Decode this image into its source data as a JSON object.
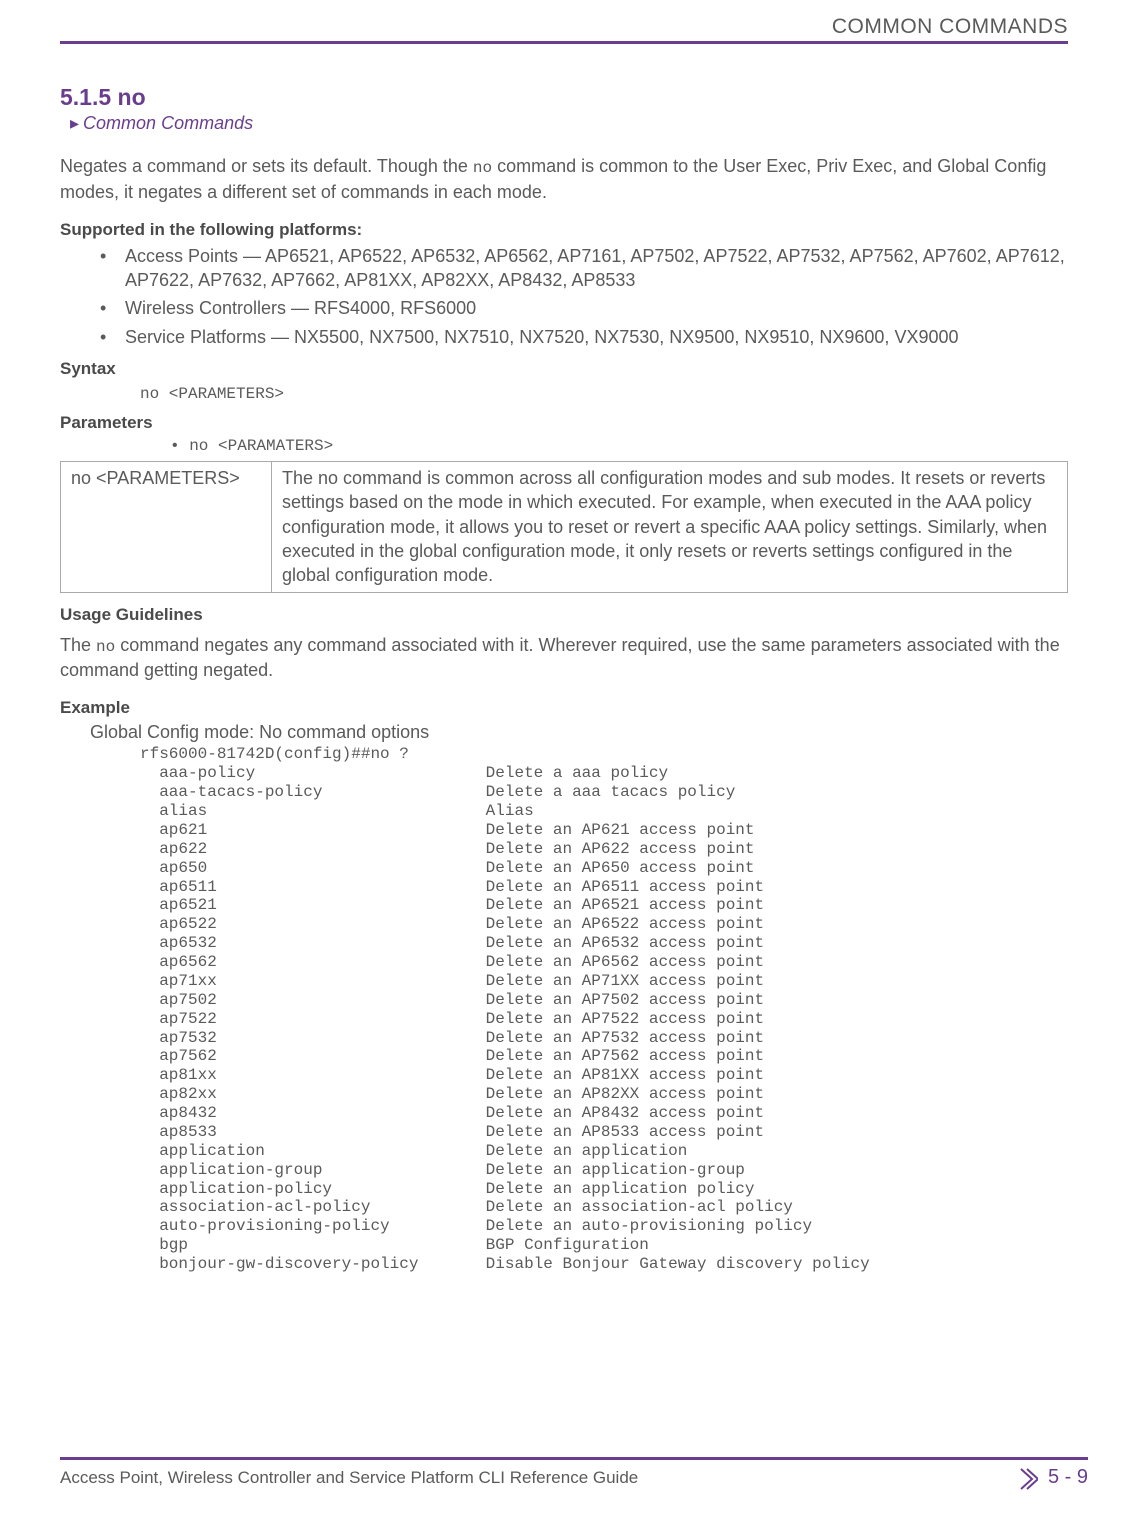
{
  "header": {
    "running_head": "COMMON COMMANDS"
  },
  "section": {
    "number": "5.1.5 no",
    "breadcrumb": "Common Commands",
    "intro_a": "Negates a command or sets its default. Though the ",
    "intro_code": "no",
    "intro_b": " command is common to the User Exec, Priv Exec, and Global Config modes, it negates a different set of commands in each mode."
  },
  "platforms": {
    "heading": "Supported in the following platforms:",
    "items": [
      "Access Points — AP6521, AP6522, AP6532, AP6562, AP7161, AP7502, AP7522, AP7532, AP7562, AP7602, AP7612, AP7622, AP7632, AP7662, AP81XX, AP82XX, AP8432, AP8533",
      "Wireless Controllers — RFS4000, RFS6000",
      "Service Platforms — NX5500, NX7500, NX7510, NX7520, NX7530, NX9500, NX9510, NX9600, VX9000"
    ]
  },
  "syntax": {
    "heading": "Syntax",
    "text": "no <PARAMETERS>"
  },
  "parameters": {
    "heading": "Parameters",
    "bullet": "• no <PARAMATERS>",
    "table_left": "no <PARAMETERS>",
    "table_right": "The no command is common across all configuration modes and sub modes. It resets or reverts settings based on the mode in which executed. For example, when executed in the AAA policy configuration mode, it allows you to reset or revert a specific AAA policy settings. Similarly, when executed in the global configuration mode, it only resets or reverts settings configured in the global configuration mode."
  },
  "usage": {
    "heading": "Usage Guidelines",
    "text_a": "The ",
    "text_code": "no",
    "text_b": " command negates any command associated with it. Wherever required, use the same parameters associated with the command getting negated."
  },
  "example": {
    "heading": "Example",
    "intro": "Global Config mode: No command options",
    "prompt": "rfs6000-81742D(config)##no ?",
    "rows": [
      [
        "aaa-policy",
        "Delete a aaa policy"
      ],
      [
        "aaa-tacacs-policy",
        "Delete a aaa tacacs policy"
      ],
      [
        "alias",
        "Alias"
      ],
      [
        "ap621",
        "Delete an AP621 access point"
      ],
      [
        "ap622",
        "Delete an AP622 access point"
      ],
      [
        "ap650",
        "Delete an AP650 access point"
      ],
      [
        "ap6511",
        "Delete an AP6511 access point"
      ],
      [
        "ap6521",
        "Delete an AP6521 access point"
      ],
      [
        "ap6522",
        "Delete an AP6522 access point"
      ],
      [
        "ap6532",
        "Delete an AP6532 access point"
      ],
      [
        "ap6562",
        "Delete an AP6562 access point"
      ],
      [
        "ap71xx",
        "Delete an AP71XX access point"
      ],
      [
        "ap7502",
        "Delete an AP7502 access point"
      ],
      [
        "ap7522",
        "Delete an AP7522 access point"
      ],
      [
        "ap7532",
        "Delete an AP7532 access point"
      ],
      [
        "ap7562",
        "Delete an AP7562 access point"
      ],
      [
        "ap81xx",
        "Delete an AP81XX access point"
      ],
      [
        "ap82xx",
        "Delete an AP82XX access point"
      ],
      [
        "ap8432",
        "Delete an AP8432 access point"
      ],
      [
        "ap8533",
        "Delete an AP8533 access point"
      ],
      [
        "application",
        "Delete an application"
      ],
      [
        "application-group",
        "Delete an application-group"
      ],
      [
        "application-policy",
        "Delete an application policy"
      ],
      [
        "association-acl-policy",
        "Delete an association-acl policy"
      ],
      [
        "auto-provisioning-policy",
        "Delete an auto-provisioning policy"
      ],
      [
        "bgp",
        "BGP Configuration"
      ],
      [
        "bonjour-gw-discovery-policy",
        "Disable Bonjour Gateway discovery policy"
      ]
    ]
  },
  "footer": {
    "left": "Access Point, Wireless Controller and Service Platform CLI Reference Guide",
    "right": "5 - 9"
  }
}
